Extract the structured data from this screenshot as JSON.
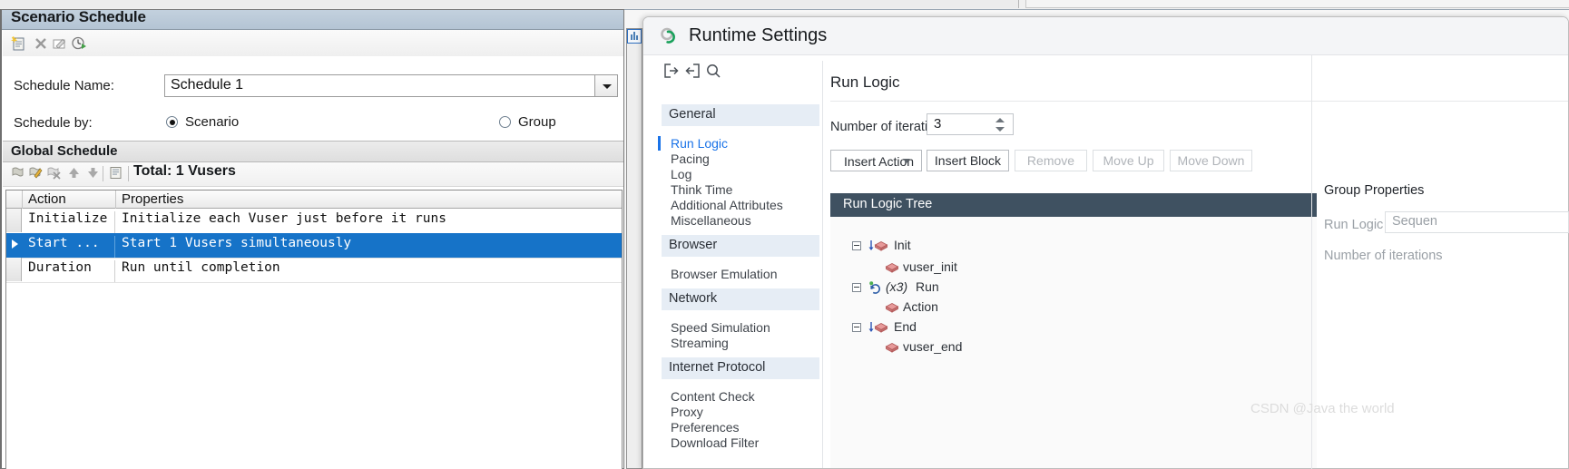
{
  "scenario_pane": {
    "title": "Scenario Schedule",
    "toolbar_icons": [
      "new-schedule-icon",
      "delete-icon",
      "edit-icon",
      "clock-run-icon"
    ],
    "schedule_name_label": "Schedule Name:",
    "schedule_name_value": "Schedule 1",
    "schedule_by_label": "Schedule by:",
    "radio_scenario": "Scenario",
    "radio_group": "Group",
    "radio_selected": "Scenario",
    "global_schedule_title": "Global Schedule",
    "global_toolbar_icons": [
      "add-action-icon",
      "edit-action-icon",
      "delete-action-icon",
      "move-up-icon",
      "move-down-icon",
      "copy-icon"
    ],
    "total_label": "Total: 1 Vusers",
    "table": {
      "columns": [
        "Action",
        "Properties"
      ],
      "rows": [
        {
          "action": "Initialize",
          "properties": "Initialize each Vuser just before it runs",
          "selected": false
        },
        {
          "action": "Start  ...",
          "properties": "Start 1 Vusers simultaneously",
          "selected": true
        },
        {
          "action": "Duration",
          "properties": "Run until completion",
          "selected": false
        }
      ]
    }
  },
  "dialog": {
    "title": "Runtime Settings",
    "title_icon": "runtime-settings-icon",
    "sidebar": {
      "tools": [
        "expand-all-icon",
        "collapse-all-icon",
        "search-icon"
      ],
      "groups": [
        {
          "label": "General",
          "items": [
            {
              "label": "Run Logic",
              "active": true
            },
            {
              "label": "Pacing",
              "active": false
            },
            {
              "label": "Log",
              "active": false
            },
            {
              "label": "Think Time",
              "active": false
            },
            {
              "label": "Additional Attributes",
              "active": false
            },
            {
              "label": "Miscellaneous",
              "active": false
            }
          ]
        },
        {
          "label": "Browser",
          "items": [
            {
              "label": "Browser Emulation",
              "active": false
            }
          ]
        },
        {
          "label": "Network",
          "items": [
            {
              "label": "Speed Simulation",
              "active": false
            },
            {
              "label": "Streaming",
              "active": false
            }
          ]
        },
        {
          "label": "Internet Protocol",
          "items": [
            {
              "label": "Content Check",
              "active": false
            },
            {
              "label": "Proxy",
              "active": false
            },
            {
              "label": "Preferences",
              "active": false
            },
            {
              "label": "Download Filter",
              "active": false
            }
          ]
        }
      ]
    },
    "main": {
      "title": "Run Logic",
      "iterations_label": "Number of iterations",
      "iterations_value": "3",
      "buttons": [
        {
          "label": "Insert Action",
          "disabled": false,
          "dropdown": true
        },
        {
          "label": "Insert Block",
          "disabled": false,
          "dropdown": false
        },
        {
          "label": "Remove",
          "disabled": true,
          "dropdown": false
        },
        {
          "label": "Move Up",
          "disabled": true,
          "dropdown": false
        },
        {
          "label": "Move Down",
          "disabled": true,
          "dropdown": false
        }
      ],
      "tree_title": "Run Logic Tree",
      "tree": [
        {
          "label": "Init",
          "icon": "init-brick-icon",
          "level": 0,
          "expandable": true,
          "highlight": true,
          "prefix": ""
        },
        {
          "label": "vuser_init",
          "icon": "brick-icon",
          "level": 1,
          "expandable": false,
          "highlight": false,
          "prefix": ""
        },
        {
          "label": "Run",
          "icon": "loop-icon",
          "level": 0,
          "expandable": true,
          "highlight": false,
          "prefix": "(x3)"
        },
        {
          "label": "Action",
          "icon": "brick-icon",
          "level": 1,
          "expandable": false,
          "highlight": false,
          "prefix": ""
        },
        {
          "label": "End",
          "icon": "end-brick-icon",
          "level": 0,
          "expandable": true,
          "highlight": false,
          "prefix": ""
        },
        {
          "label": "vuser_end",
          "icon": "brick-icon",
          "level": 1,
          "expandable": false,
          "highlight": false,
          "prefix": ""
        }
      ]
    },
    "properties": {
      "title": "Group Properties",
      "run_logic_label": "Run Logic",
      "run_logic_value": "Sequen",
      "iterations_label": "Number of iterations"
    }
  },
  "watermark": "CSDN @Java the world",
  "colors": {
    "selection_blue": "#1673c8",
    "accent_blue": "#1a73e8",
    "tree_header": "#3f5161",
    "group_header_bg": "#e6edf5",
    "title_bar": "#b4c4d4"
  }
}
